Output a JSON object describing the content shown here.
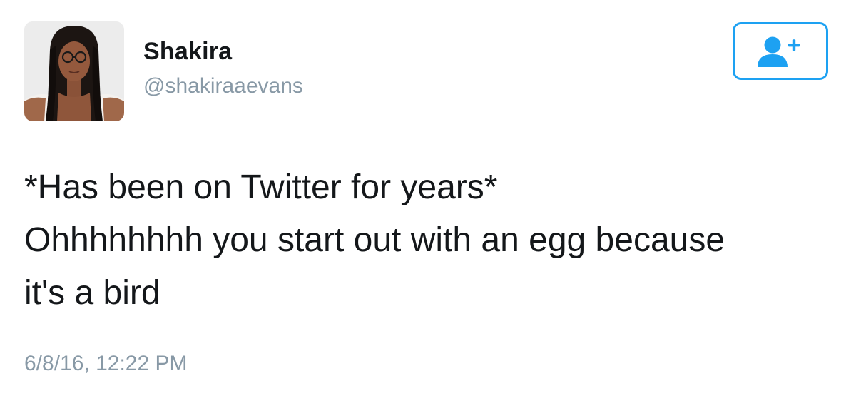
{
  "user": {
    "display_name": "Shakira",
    "handle": "@shakiraaevans",
    "avatar_icon": "profile-photo"
  },
  "follow_button": {
    "icon": "add-user-icon",
    "color": "#1da1f2"
  },
  "tweet": {
    "lines": [
      "*Has been on Twitter for years*",
      "Ohhhhhhhh you start out with an egg because",
      "it's a bird"
    ],
    "timestamp": "6/8/16, 12:22 PM"
  },
  "colors": {
    "text": "#14171a",
    "secondary": "#8899a6",
    "accent": "#1da1f2"
  }
}
